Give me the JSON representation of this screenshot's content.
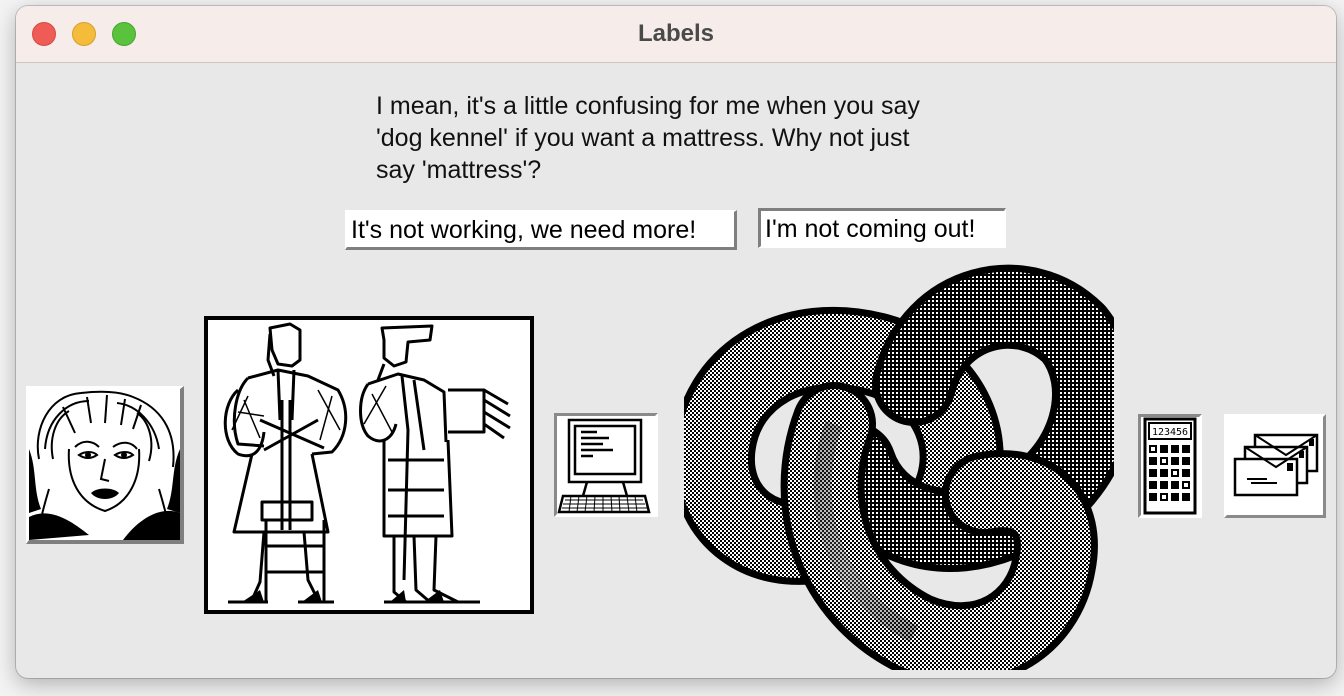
{
  "window": {
    "title": "Labels"
  },
  "label": {
    "text": "I mean, it's a little confusing for me when you say\n'dog kennel' if you want a mattress.  Why not just\nsay 'mattress'?"
  },
  "buttons": {
    "more_label": "It's not working, we need more!",
    "not_coming_label": "I'm not coming out!"
  },
  "images": [
    {
      "icon": "woman-portrait-icon"
    },
    {
      "icon": "workers-illustration-icon"
    },
    {
      "icon": "computer-icon"
    },
    {
      "icon": "trefoil-knot-icon"
    },
    {
      "icon": "calculator-icon"
    },
    {
      "icon": "mail-envelopes-icon"
    }
  ],
  "calculator": {
    "display": "123456"
  }
}
